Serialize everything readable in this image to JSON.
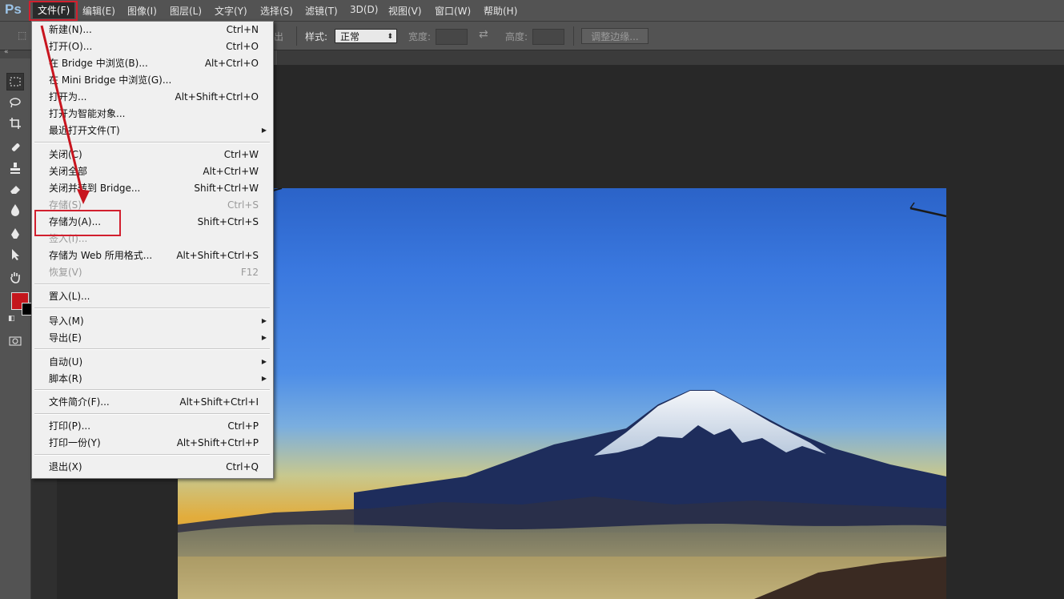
{
  "app": {
    "logo": "Ps"
  },
  "menubar": {
    "items": [
      "文件(F)",
      "编辑(E)",
      "图像(I)",
      "图层(L)",
      "文字(Y)",
      "选择(S)",
      "滤镜(T)",
      "3D(D)",
      "视图(V)",
      "窗口(W)",
      "帮助(H)"
    ],
    "active": "文件(F)"
  },
  "options": {
    "partial_label": "出",
    "style_label": "样式:",
    "style_value": "正常",
    "width_label": "宽度:",
    "height_label": "高度:",
    "refine_edge": "调整边缘..."
  },
  "tools": [
    "marquee-icon",
    "lasso-icon",
    "crop-icon",
    "healing-icon",
    "stamp-icon",
    "eraser-icon",
    "blur-icon",
    "pen-icon",
    "selection-arrow-icon",
    "hand-icon"
  ],
  "colors": {
    "foreground": "#c4161c",
    "background": "#000000",
    "highlight": "#d21f2e"
  },
  "file_menu": {
    "items": [
      {
        "label": "新建(N)...",
        "shortcut": "Ctrl+N"
      },
      {
        "label": "打开(O)...",
        "shortcut": "Ctrl+O"
      },
      {
        "label": "在 Bridge 中浏览(B)...",
        "shortcut": "Alt+Ctrl+O"
      },
      {
        "label": "在 Mini Bridge 中浏览(G)...",
        "shortcut": ""
      },
      {
        "label": "打开为...",
        "shortcut": "Alt+Shift+Ctrl+O"
      },
      {
        "label": "打开为智能对象...",
        "shortcut": ""
      },
      {
        "label": "最近打开文件(T)",
        "shortcut": "",
        "submenu": "▶"
      },
      {
        "label": "关闭(C)",
        "shortcut": "Ctrl+W"
      },
      {
        "label": "关闭全部",
        "shortcut": "Alt+Ctrl+W"
      },
      {
        "label": "关闭并转到 Bridge...",
        "shortcut": "Shift+Ctrl+W"
      },
      {
        "label": "存储(S)",
        "shortcut": "Ctrl+S",
        "disabled": true
      },
      {
        "label": "存储为(A)...",
        "shortcut": "Shift+Ctrl+S"
      },
      {
        "label": "签入(I)...",
        "shortcut": "",
        "disabled": true
      },
      {
        "label": "存储为 Web 所用格式...",
        "shortcut": "Alt+Shift+Ctrl+S"
      },
      {
        "label": "恢复(V)",
        "shortcut": "F12",
        "disabled": true
      },
      {
        "label": "置入(L)...",
        "shortcut": ""
      },
      {
        "label": "导入(M)",
        "shortcut": "",
        "submenu": "▶"
      },
      {
        "label": "导出(E)",
        "shortcut": "",
        "submenu": "▶"
      },
      {
        "label": "自动(U)",
        "shortcut": "",
        "submenu": "▶"
      },
      {
        "label": "脚本(R)",
        "shortcut": "",
        "submenu": "▶"
      },
      {
        "label": "文件简介(F)...",
        "shortcut": "Alt+Shift+Ctrl+I"
      },
      {
        "label": "打印(P)...",
        "shortcut": "Ctrl+P"
      },
      {
        "label": "打印一份(Y)",
        "shortcut": "Alt+Shift+Ctrl+P"
      },
      {
        "label": "退出(X)",
        "shortcut": "Ctrl+Q"
      }
    ]
  }
}
